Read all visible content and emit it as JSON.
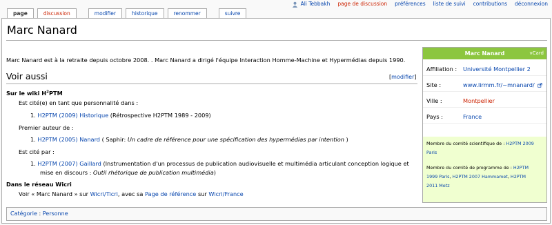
{
  "tabs": [
    {
      "label": "page",
      "selected": true
    },
    {
      "label": "discussion",
      "new": true
    },
    {
      "label": "modifier"
    },
    {
      "label": "historique"
    },
    {
      "label": "renommer"
    },
    {
      "label": "suivre"
    }
  ],
  "personal": {
    "user": "Ali Tebbakh",
    "talk": "page de discussion",
    "prefs": "préférences",
    "watchlist": "liste de suivi",
    "contribs": "contributions",
    "logout": "déconnexion"
  },
  "page": {
    "title": "Marc Nanard",
    "intro": "Marc Nanard est à la retraite depuis octobre 2008. . Marc Nanard a dirigé l'équipe Interaction Homme-Machine et Hypermédias depuis 1990."
  },
  "section": {
    "heading": "Voir aussi",
    "edit_open": "[",
    "edit_label": "modifier",
    "edit_close": "]",
    "wiki_heading": "Sur le wiki H",
    "wiki_heading_sup": "2",
    "wiki_heading_tail": "PTM",
    "cited_as": "Est cité(e) en tant que personnalité dans :",
    "item1_num": "1.",
    "item1_link": "H2PTM (2009) Historique",
    "item1_text": " (Rétrospective H2PTM 1989 - 2009)",
    "first_author": "Premier auteur de :",
    "item2_num": "1.",
    "item2_link": "H2PTM (2005) Nanard",
    "item2_text_a": " ( Saphir: ",
    "item2_text_i": "Un cadre de référence pour une spécification des hypermédias par intention",
    "item2_text_b": " )",
    "cited_by": "Est cité par :",
    "item3_num": "1.",
    "item3_link": "H2PTM (2007) Gaillard",
    "item3_text_1": " (Instrumentation d'un processus de publication audiovisuelle et multimédia articulant conception logique et",
    "item3_text_2a": "mise en discours : ",
    "item3_text_2i": "Outil rhétorique de publication multimédia",
    "item3_text_2b": ")",
    "wicri_heading": "Dans le réseau Wicri",
    "wicri_1": "Voir « Marc Nanard » sur ",
    "wicri_link1": "Wicri/Ticri",
    "wicri_2": ", avec sa ",
    "wicri_link2": "Page de référence",
    "wicri_3": " sur ",
    "wicri_link3": "Wicri/France"
  },
  "infobox": {
    "name": "Marc Nanard",
    "vcard": "vCard",
    "rows": [
      {
        "label": "Affiliation :",
        "value": "Université Montpellier 2"
      },
      {
        "label": "Site :",
        "value": "www.lirmm.fr/~mnanard/"
      },
      {
        "label": "Ville :",
        "value": "Montpellier"
      },
      {
        "label": "Pays :",
        "value": "France"
      }
    ],
    "sci_label": "Membre du comité scientifique de : ",
    "sci_link1": "H2PTM 2009",
    "sci_link2": "Paris",
    "prog_label": "Membre du comité de programme de : ",
    "prog_link1": "H2PTM",
    "prog_link2": "1999 Paris",
    "prog_sep": ", ",
    "prog_link3": "H2PTM 2007 Hammamet",
    "prog_link4": "H2PTM",
    "prog_link5": "2011 Metz"
  },
  "category": {
    "label": "Catégorie",
    "sep": " : ",
    "value": "Personne"
  },
  "colors": {
    "link": "#0645ad",
    "new_link": "#cc2200",
    "infobox_head": "#8cc63f",
    "infobox_green": "#f0ffd0"
  }
}
